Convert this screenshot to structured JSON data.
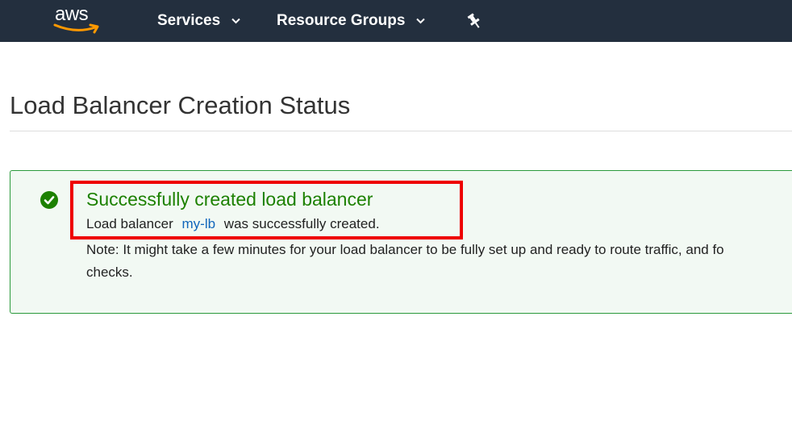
{
  "topnav": {
    "logo_text": "aws",
    "services_label": "Services",
    "resource_groups_label": "Resource Groups",
    "pin_icon": "pushpin-icon",
    "background": "#232f3e"
  },
  "page": {
    "title": "Load Balancer Creation Status"
  },
  "status": {
    "icon": "check-circle-icon",
    "color": "#1d8102",
    "title": "Successfully created load balancer",
    "line_prefix": "Load balancer",
    "lb_name": "my-lb",
    "line_suffix": "was successfully created.",
    "note_line1": "Note: It might take a few minutes for your load balancer to be fully set up and ready to route traffic, and fo",
    "note_line2": "checks."
  },
  "annotation": {
    "highlight_color": "#ee0000"
  }
}
